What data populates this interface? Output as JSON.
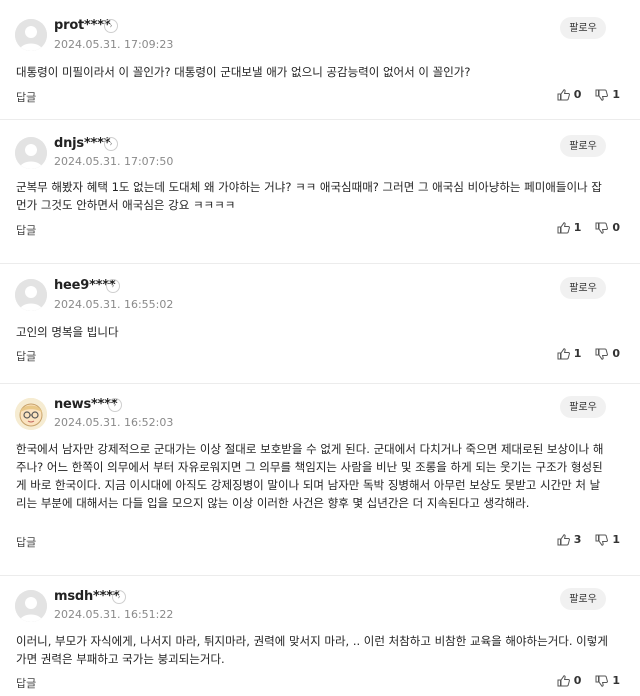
{
  "comments": [
    {
      "nick": "prot****",
      "date": "2024.05.31. 17:09:23",
      "follow": "팔로우",
      "text": "대통령이 미필이라서 이 꼴인가? 대통령이 군대보낼 애가 없으니 공감능력이 없어서 이 꼴인가?",
      "reply": "답글",
      "likes": "0",
      "dislikes": "1",
      "avatar": "default"
    },
    {
      "nick": "dnjs****",
      "date": "2024.05.31. 17:07:50",
      "follow": "팔로우",
      "text": "군복무 해봤자 혜택 1도 없는데 도대체 왜 가야하는 거냐? ㅋㅋ 애국심때매? 그러면 그 애국심 비아냥하는 페미애들이나 잡먼가 그것도 안하면서 애국심은 강요 ㅋㅋㅋㅋ",
      "reply": "답글",
      "likes": "1",
      "dislikes": "0",
      "avatar": "default"
    },
    {
      "nick": "hee9****",
      "date": "2024.05.31. 16:55:02",
      "follow": "팔로우",
      "text": "고인의 명복을 빕니다",
      "reply": "답글",
      "likes": "1",
      "dislikes": "0",
      "avatar": "default"
    },
    {
      "nick": "news****",
      "date": "2024.05.31. 16:52:03",
      "follow": "팔로우",
      "text": "한국에서 남자만 강제적으로 군대가는 이상 절대로 보호받을 수 없게 된다. 군대에서 다치거나 죽으면 제대로된 보상이나 해 주나? 어느 한쪽이 의무에서 부터 자유로워지면 그 의무를 책임지는 사람을 비난 및 조롱을 하게 되는 웃기는 구조가 형성된게 바로 한국이다. 지금 이시대에 아직도 강제징병이 말이나 되며 남자만 독박 징병해서 아무런 보상도 못받고 시간만 처 날리는 부분에 대해서는 다들 입을 모으지 않는 이상 이러한 사건은 향후 몇 십년간은 더 지속된다고 생각해라.",
      "reply": "답글",
      "likes": "3",
      "dislikes": "1",
      "avatar": "character"
    },
    {
      "nick": "msdh****",
      "date": "2024.05.31. 16:51:22",
      "follow": "팔로우",
      "text": "이러니, 부모가 자식에게, 나서지 마라, 튀지마라, 권력에 맞서지 마라, .. 이런 처참하고 비참한 교육을 해야하는거다. 이렇게 가면 권력은 부패하고 국가는 붕괴되는거다.",
      "reply": "답글",
      "likes": "0",
      "dislikes": "1",
      "avatar": "default"
    }
  ],
  "icons": {
    "info": "info-chevron-icon",
    "like": "thumbs-up-icon",
    "dislike": "thumbs-down-icon",
    "avatar": "default-avatar-icon"
  },
  "colors": {
    "accent": "#111111",
    "muted": "#8a8a8a",
    "divider": "#ececec",
    "button_bg": "#f1f1f1"
  }
}
